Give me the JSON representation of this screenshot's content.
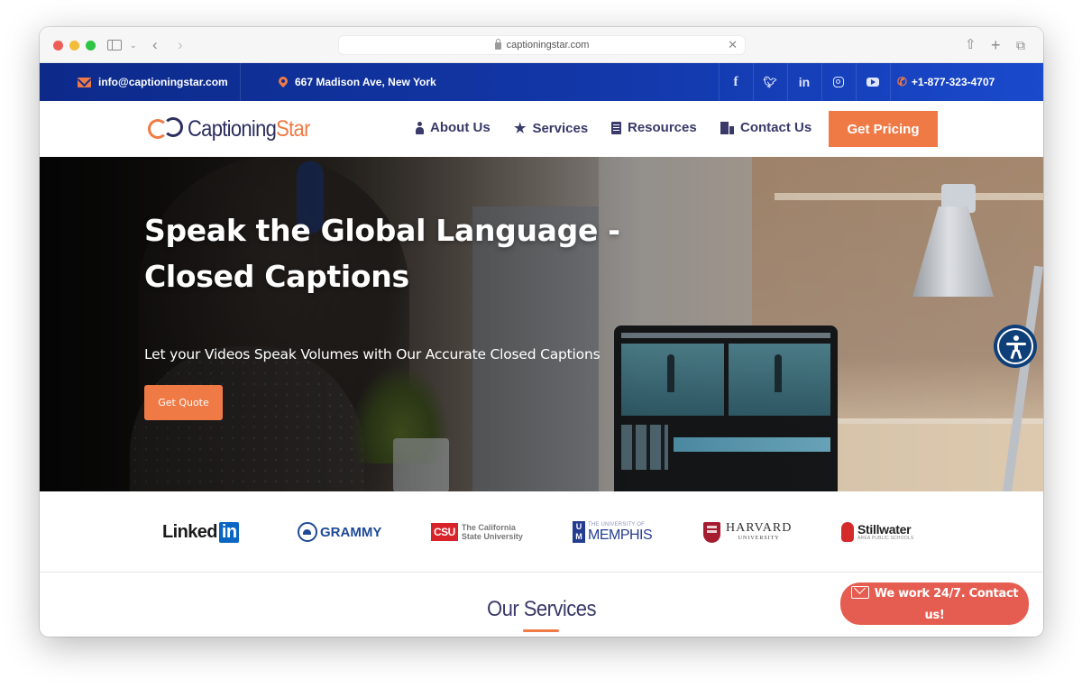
{
  "browser": {
    "url": "captioningstar.com",
    "icons": [
      "sidebar-icon",
      "chevron-down-icon",
      "back-icon",
      "forward-icon",
      "lock-icon",
      "clear-icon",
      "share-icon",
      "new-tab-icon",
      "tabs-overview-icon"
    ]
  },
  "topbar": {
    "email": "info@captioningstar.com",
    "address": "667 Madison Ave, New York",
    "phone": "+1-877-323-4707",
    "social": [
      {
        "name": "facebook",
        "glyph": "f"
      },
      {
        "name": "twitter",
        "glyph": "🐦"
      },
      {
        "name": "linkedin",
        "glyph": "in"
      },
      {
        "name": "instagram",
        "glyph": ""
      },
      {
        "name": "youtube",
        "glyph": ""
      }
    ]
  },
  "nav": {
    "logo_main": "Captioning",
    "logo_accent": "Star",
    "items": [
      {
        "label": "About Us",
        "icon": "person-icon"
      },
      {
        "label": "Services",
        "icon": "star-icon"
      },
      {
        "label": "Resources",
        "icon": "document-icon"
      },
      {
        "label": "Contact Us",
        "icon": "building-icon"
      }
    ],
    "cta": "Get Pricing"
  },
  "hero": {
    "title_line1": "Speak the Global Language -",
    "title_line2": "Closed Captions",
    "subtitle": "Let your Videos Speak Volumes with Our Accurate Closed Captions",
    "button": "Get Quote"
  },
  "clients": {
    "linkedin": {
      "text": "Linked",
      "badge": "in"
    },
    "grammy": {
      "text": "GRAMMY"
    },
    "csu": {
      "badge": "CSU",
      "line1": "The California",
      "line2": "State University"
    },
    "memphis": {
      "badge_top": "U",
      "badge_bottom": "M",
      "small": "THE UNIVERSITY OF",
      "big": "MEMPHIS"
    },
    "harvard": {
      "name": "HARVARD",
      "sub": "UNIVERSITY"
    },
    "stillwater": {
      "name": "Stillwater",
      "sub": "AREA PUBLIC SCHOOLS"
    }
  },
  "services": {
    "title": "Our Services"
  },
  "contact_float": {
    "line1": "We work 24/7. Contact",
    "line2": "us!"
  },
  "colors": {
    "brand_navy": "#2c2f5e",
    "accent_orange": "#f07a45",
    "topbar_blue": "#1237a8",
    "contact_red": "#e55d51",
    "a11y_blue": "#0f3f78"
  }
}
